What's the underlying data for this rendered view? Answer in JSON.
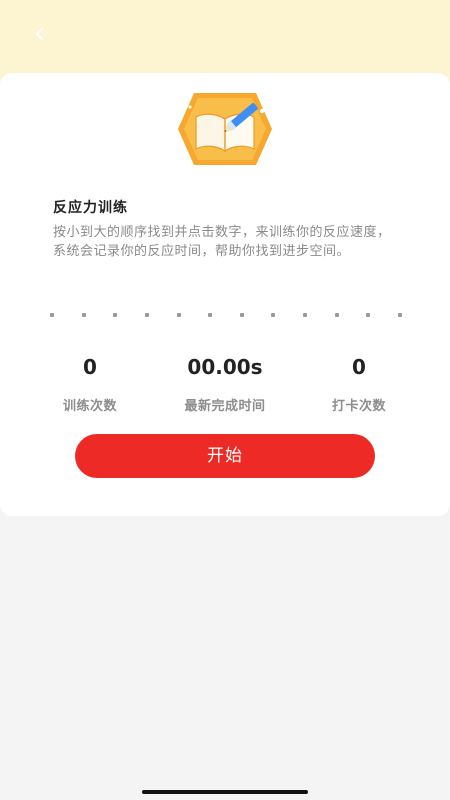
{
  "header": {
    "back_icon": "chevron-left-icon"
  },
  "card": {
    "hero_icon": "book-pencil-badge-icon",
    "title": "反应力训练",
    "description": "按小到大的顺序找到并点击数字，来训练你的反应速度，系统会记录你的反应时间，帮助你找到进步空间。",
    "dot_count": 12
  },
  "stats": [
    {
      "value": "0",
      "label": "训练次数"
    },
    {
      "value": "00.00s",
      "label": "最新完成时间"
    },
    {
      "value": "0",
      "label": "打卡次数"
    }
  ],
  "start_button": {
    "label": "开始"
  },
  "colors": {
    "header_bg": "#fdf4d2",
    "accent_red": "#ee2a26",
    "badge_orange": "#f6a92e",
    "pencil_blue": "#3f8ef2"
  }
}
